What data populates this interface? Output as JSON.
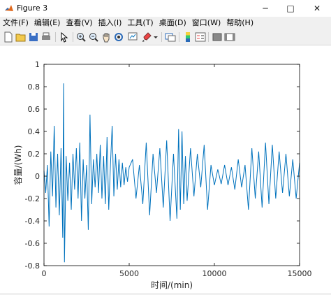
{
  "window": {
    "title": "Figure 3"
  },
  "window_controls": {
    "minimize": "─",
    "maximize": "□",
    "close": "✕"
  },
  "menu": [
    "文件(F)",
    "编辑(E)",
    "查看(V)",
    "插入(I)",
    "工具(T)",
    "桌面(D)",
    "窗口(W)",
    "帮助(H)"
  ],
  "toolbar_icons": [
    "new-figure-icon",
    "open-icon",
    "save-icon",
    "print-icon",
    "pointer-icon",
    "zoom-in-icon",
    "zoom-out-icon",
    "pan-icon",
    "rotate-3d-icon",
    "data-cursor-icon",
    "brush-icon",
    "link-plot-icon",
    "colorbar-icon",
    "legend-icon",
    "hide-plot-tools-icon",
    "show-plot-tools-icon"
  ],
  "colors": {
    "line": "#0072BD",
    "axes": "#000000",
    "background": "#ffffff"
  },
  "chart_data": {
    "type": "line",
    "title": "",
    "xlabel": "时间/(min)",
    "ylabel": "容量/(Wh)",
    "xlim": [
      0,
      15000
    ],
    "ylim": [
      -0.8,
      1
    ],
    "xticks": [
      "0",
      "5000",
      "10000",
      "15000"
    ],
    "yticks": [
      "-0.8",
      "-0.6",
      "-0.4",
      "-0.2",
      "0",
      "0.2",
      "0.4",
      "0.6",
      "0.8",
      "1"
    ],
    "grid": false,
    "series": [
      {
        "x": [
          0,
          100,
          200,
          300,
          400,
          500,
          600,
          700,
          800,
          900,
          1000,
          1100,
          1150,
          1200,
          1300,
          1400,
          1500,
          1600,
          1700,
          1800,
          1900,
          2000,
          2100,
          2200,
          2300,
          2400,
          2500,
          2600,
          2700,
          2800,
          2900,
          3000,
          3100,
          3200,
          3300,
          3400,
          3500,
          3600,
          3700,
          3800,
          3900,
          4000,
          4100,
          4200,
          4300,
          4400,
          4500,
          4600,
          4700,
          4800,
          4900,
          5000,
          5200,
          5400,
          5600,
          5800,
          6000,
          6200,
          6400,
          6600,
          6800,
          7000,
          7200,
          7400,
          7600,
          7800,
          7900,
          8000,
          8100,
          8200,
          8300,
          8400,
          8600,
          8800,
          9000,
          9200,
          9400,
          9600,
          9800,
          10000,
          10200,
          10400,
          10600,
          10800,
          11000,
          11200,
          11400,
          11600,
          11800,
          12000,
          12200,
          12400,
          12600,
          12800,
          13000,
          13200,
          13400,
          13600,
          13800,
          14000,
          14200,
          14400,
          14600,
          14800,
          15000
        ],
        "y": [
          0.05,
          -0.15,
          0.1,
          -0.45,
          0.22,
          -0.18,
          0.45,
          -0.28,
          0.2,
          -0.35,
          0.25,
          -0.55,
          0.83,
          -0.77,
          0.18,
          -0.22,
          0.12,
          -0.3,
          0.2,
          -0.12,
          0.25,
          -0.2,
          0.3,
          -0.4,
          0.15,
          -0.2,
          0.1,
          -0.48,
          0.55,
          -0.25,
          0.15,
          -0.1,
          0.2,
          -0.15,
          0.28,
          -0.2,
          0.18,
          -0.25,
          0.35,
          -0.3,
          0.1,
          0.45,
          -0.18,
          0.2,
          -0.12,
          0.15,
          -0.1,
          0.12,
          -0.08,
          0.08,
          -0.05,
          0.08,
          0.15,
          -0.2,
          0.1,
          -0.25,
          0.3,
          -0.35,
          0.2,
          -0.15,
          0.25,
          -0.28,
          0.32,
          -0.4,
          0.2,
          -0.38,
          0.42,
          -0.3,
          0.4,
          -0.25,
          0.18,
          -0.22,
          0.25,
          -0.18,
          0.2,
          -0.1,
          0.28,
          -0.3,
          0.1,
          -0.08,
          0.06,
          -0.07,
          0.1,
          -0.08,
          0.08,
          -0.12,
          0.15,
          -0.1,
          0.1,
          -0.3,
          0.25,
          -0.2,
          0.22,
          -0.28,
          0.3,
          -0.25,
          0.28,
          -0.2,
          0.22,
          -0.15,
          0.2,
          -0.18,
          0.15,
          -0.2,
          0.12
        ]
      }
    ]
  }
}
